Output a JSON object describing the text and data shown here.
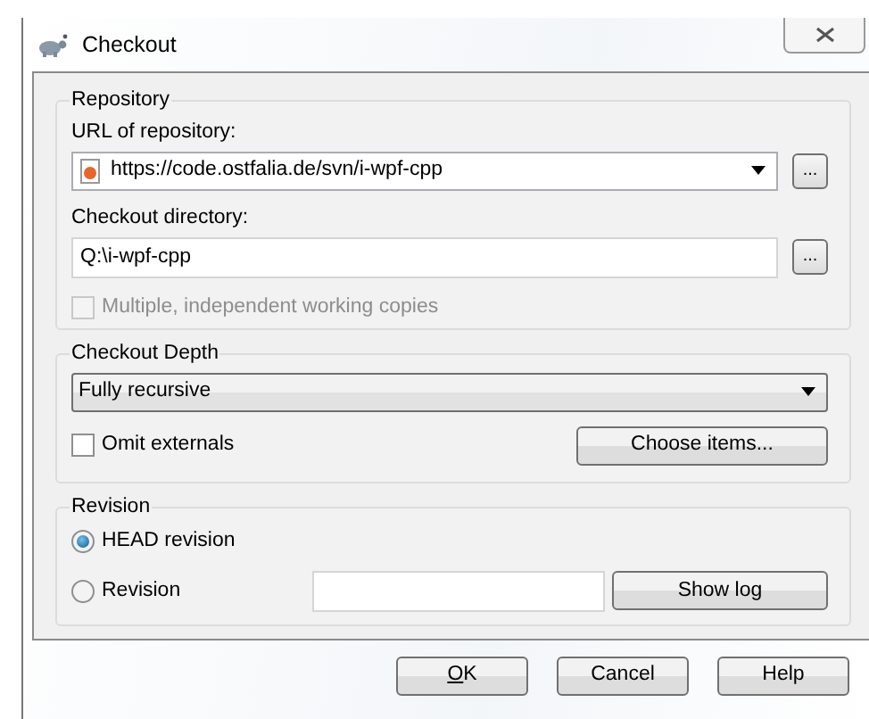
{
  "window": {
    "title": "Checkout"
  },
  "repository": {
    "label": "Repository",
    "url_label": "URL of repository:",
    "url": "https://code.ostfalia.de/svn/i-wpf-cpp",
    "url_browse": "...",
    "dir_label": "Checkout directory:",
    "dir": "Q:\\i-wpf-cpp",
    "dir_browse": "...",
    "multiple": {
      "label": "Multiple, independent working copies",
      "checked": false,
      "disabled": true
    }
  },
  "depth": {
    "label": "Checkout Depth",
    "value": "Fully recursive",
    "omit": {
      "label": "Omit externals",
      "checked": false,
      "disabled": false
    },
    "choose": "Choose items..."
  },
  "revision": {
    "label": "Revision",
    "options": [
      {
        "label": "HEAD revision",
        "selected": true
      },
      {
        "label": "Revision",
        "selected": false
      }
    ],
    "show_log": "Show log"
  },
  "buttons": [
    {
      "label": "OK",
      "underline_first": true
    },
    {
      "label": "Cancel",
      "underline_first": false
    },
    {
      "label": "Help",
      "underline_first": false
    }
  ]
}
